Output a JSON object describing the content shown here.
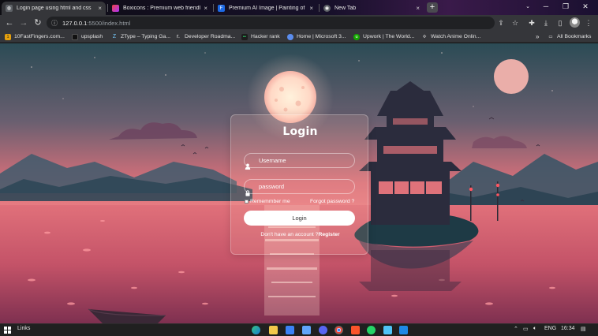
{
  "browser": {
    "tabs": [
      {
        "title": "Login page using html and css",
        "active": true,
        "favicon": "globe-icon"
      },
      {
        "title": "Boxicons : Premium web friendly",
        "active": false,
        "favicon": "boxicons-icon"
      },
      {
        "title": "Premium AI Image | Painting of",
        "active": false,
        "favicon": "freepik-icon"
      },
      {
        "title": "New Tab",
        "active": false,
        "favicon": "chrome-icon"
      }
    ],
    "new_tab_label": "+",
    "url": {
      "host": "127.0.0.1",
      "path": ":5500/index.html"
    },
    "window_controls": {
      "minimize": "─",
      "maximize": "❐",
      "close": "✕"
    },
    "bookmarks": [
      {
        "label": "10FastFingers.com...",
        "icon": "10ff-icon"
      },
      {
        "label": "upsplash",
        "icon": "unsplash-icon"
      },
      {
        "label": "ZType – Typing Ga...",
        "icon": "ztype-icon"
      },
      {
        "label": "Developer Roadma...",
        "icon": "roadmap-icon"
      },
      {
        "label": "Hacker rank",
        "icon": "hackerrank-icon"
      },
      {
        "label": "Home | Microsoft 3...",
        "icon": "microsoft-icon"
      },
      {
        "label": "Upwork | The World...",
        "icon": "upwork-icon"
      },
      {
        "label": "Watch Anime Onlin...",
        "icon": "anime-icon"
      }
    ],
    "bookmarks_overflow": "»",
    "all_bookmarks": "All Bookmarks"
  },
  "login": {
    "title": "Login",
    "username_placeholder": "Username",
    "password_placeholder": "password",
    "remember_label": "Rememmber me",
    "forgot_label": "Forgot password ?",
    "button_label": "Login",
    "register_prompt": "Don't have an account ?",
    "register_link": "Register"
  },
  "taskbar": {
    "links_label": "Links",
    "language": "ENG",
    "time": "16:34",
    "apps": [
      "edge-icon",
      "file-explorer-icon",
      "store-icon",
      "photos-icon",
      "discord-icon",
      "chrome-icon",
      "brave-icon",
      "whatsapp-icon",
      "notepad-icon",
      "vscode-icon"
    ]
  },
  "colors": {
    "sky_top": "#2a5058",
    "sky_glow": "#f07f86",
    "water": "#c9586a",
    "accent": "#ffffff"
  }
}
